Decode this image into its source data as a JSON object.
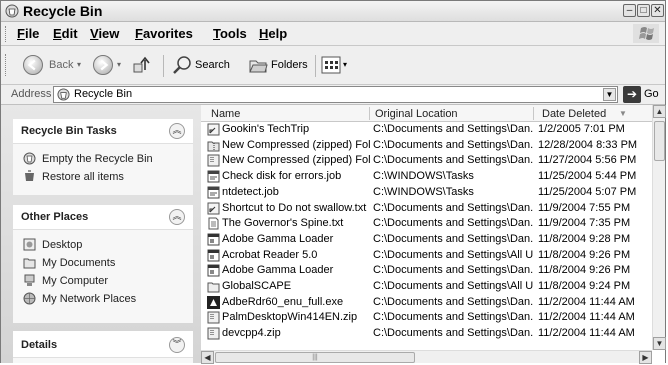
{
  "window": {
    "title": "Recycle Bin"
  },
  "menu": [
    "File",
    "Edit",
    "View",
    "Favorites",
    "Tools",
    "Help"
  ],
  "toolbar": {
    "back_label": "Back",
    "search_label": "Search",
    "folders_label": "Folders"
  },
  "address": {
    "label": "Address",
    "value": "Recycle Bin",
    "go_label": "Go"
  },
  "tasks": {
    "recycle_title": "Recycle Bin Tasks",
    "recycle_items": [
      "Empty the Recycle Bin",
      "Restore all items"
    ],
    "places_title": "Other Places",
    "places_items": [
      "Desktop",
      "My Documents",
      "My Computer",
      "My Network Places"
    ],
    "details_title": "Details"
  },
  "columns": {
    "name": "Name",
    "location": "Original Location",
    "date": "Date Deleted"
  },
  "files": [
    {
      "name": "Gookin's TechTrip",
      "location": "C:\\Documents and Settings\\Dan...",
      "date": "1/2/2005 7:01 PM",
      "icon": "shortcut-icon"
    },
    {
      "name": "New Compressed (zipped) Fol...",
      "location": "C:\\Documents and Settings\\Dan...",
      "date": "12/28/2004 8:33 PM",
      "icon": "zip-folder-icon"
    },
    {
      "name": "New Compressed (zipped) Fol...",
      "location": "C:\\Documents and Settings\\Dan...",
      "date": "11/27/2004 5:56 PM",
      "icon": "zip-icon"
    },
    {
      "name": "Check disk for errors.job",
      "location": "C:\\WINDOWS\\Tasks",
      "date": "11/25/2004 5:44 PM",
      "icon": "job-icon"
    },
    {
      "name": "ntdetect.job",
      "location": "C:\\WINDOWS\\Tasks",
      "date": "11/25/2004 5:07 PM",
      "icon": "job-icon"
    },
    {
      "name": "Shortcut to Do not swallow.txt",
      "location": "C:\\Documents and Settings\\Dan...",
      "date": "11/9/2004 7:55 PM",
      "icon": "shortcut-icon"
    },
    {
      "name": "The Governor's Spine.txt",
      "location": "C:\\Documents and Settings\\Dan...",
      "date": "11/9/2004 7:35 PM",
      "icon": "text-file-icon"
    },
    {
      "name": "Adobe Gamma Loader",
      "location": "C:\\Documents and Settings\\Dan...",
      "date": "11/8/2004 9:28 PM",
      "icon": "app-icon"
    },
    {
      "name": "Acrobat Reader 5.0",
      "location": "C:\\Documents and Settings\\All U...",
      "date": "11/8/2004 9:26 PM",
      "icon": "app-icon"
    },
    {
      "name": "Adobe Gamma Loader",
      "location": "C:\\Documents and Settings\\Dan...",
      "date": "11/8/2004 9:26 PM",
      "icon": "app-icon"
    },
    {
      "name": "GlobalSCAPE",
      "location": "C:\\Documents and Settings\\All U...",
      "date": "11/8/2004 9:24 PM",
      "icon": "folder-icon"
    },
    {
      "name": "AdbeRdr60_enu_full.exe",
      "location": "C:\\Documents and Settings\\Dan...",
      "date": "11/2/2004 11:44 AM",
      "icon": "exe-icon"
    },
    {
      "name": "PalmDesktopWin414EN.zip",
      "location": "C:\\Documents and Settings\\Dan...",
      "date": "11/2/2004 11:44 AM",
      "icon": "zip-icon"
    },
    {
      "name": "devcpp4.zip",
      "location": "C:\\Documents and Settings\\Dan...",
      "date": "11/2/2004 11:44 AM",
      "icon": "zip-icon"
    }
  ]
}
